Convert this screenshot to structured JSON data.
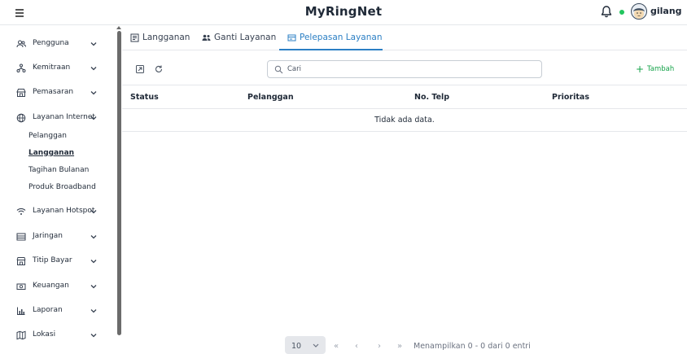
{
  "header": {
    "title": "MyRingNet",
    "username": "gilang"
  },
  "sidebar": {
    "items": [
      {
        "label": "Pengguna"
      },
      {
        "label": "Kemitraan"
      },
      {
        "label": "Pemasaran"
      },
      {
        "label": "Layanan Internet"
      },
      {
        "label": "Layanan Hotspot"
      },
      {
        "label": "Jaringan"
      },
      {
        "label": "Titip Bayar"
      },
      {
        "label": "Keuangan"
      },
      {
        "label": "Laporan"
      },
      {
        "label": "Lokasi"
      }
    ],
    "submenu": [
      {
        "label": "Pelanggan"
      },
      {
        "label": "Langganan"
      },
      {
        "label": "Tagihan Bulanan"
      },
      {
        "label": "Produk Broadband"
      }
    ]
  },
  "tabs": [
    {
      "label": "Langganan"
    },
    {
      "label": "Ganti Layanan"
    },
    {
      "label": "Pelepasan Layanan"
    }
  ],
  "search": {
    "placeholder": "Cari"
  },
  "toolbar": {
    "add_label": "Tambah"
  },
  "table": {
    "columns": [
      "Status",
      "Pelanggan",
      "No. Telp",
      "Prioritas"
    ],
    "empty_text": "Tidak ada data."
  },
  "pagination": {
    "rows_per_page": "10",
    "info": "Menampilkan 0 - 0 dari 0 entri"
  },
  "colors": {
    "accent": "#2b7fc4",
    "add": "#16a34a",
    "online": "#22c55e"
  }
}
